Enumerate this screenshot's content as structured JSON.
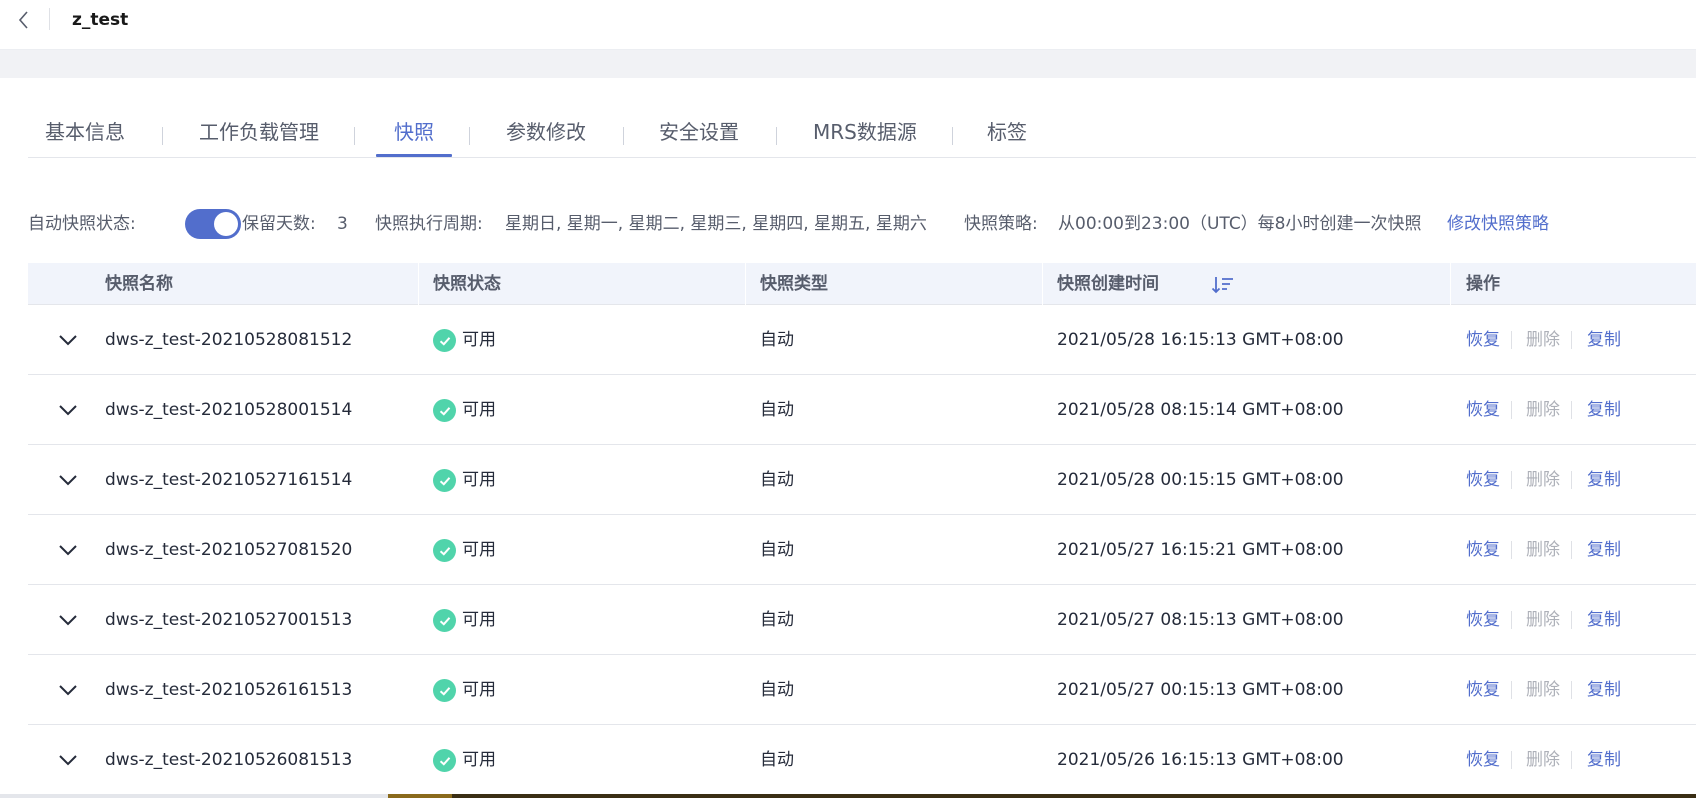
{
  "header": {
    "title": "z_test"
  },
  "tabs": [
    {
      "label": "基本信息",
      "active": false
    },
    {
      "label": "工作负载管理",
      "active": false
    },
    {
      "label": "快照",
      "active": true
    },
    {
      "label": "参数修改",
      "active": false
    },
    {
      "label": "安全设置",
      "active": false
    },
    {
      "label": "MRS数据源",
      "active": false
    },
    {
      "label": "标签",
      "active": false
    }
  ],
  "info": {
    "auto_label": "自动快照状态:",
    "auto_enabled": true,
    "retention_label": "保留天数:",
    "retention_value": "3",
    "period_label": "快照执行周期:",
    "period_value": "星期日, 星期一, 星期二, 星期三, 星期四, 星期五, 星期六",
    "policy_label": "快照策略:",
    "policy_value": "从00:00到23:00（UTC）每8小时创建一次快照",
    "modify_link": "修改快照策略"
  },
  "table": {
    "columns": [
      "快照名称",
      "快照状态",
      "快照类型",
      "快照创建时间",
      "操作"
    ],
    "actions": {
      "restore": "恢复",
      "delete": "删除",
      "copy": "复制"
    },
    "rows": [
      {
        "name": "dws-z_test-20210528081512",
        "status": "可用",
        "type": "自动",
        "created": "2021/05/28 16:15:13 GMT+08:00"
      },
      {
        "name": "dws-z_test-20210528001514",
        "status": "可用",
        "type": "自动",
        "created": "2021/05/28 08:15:14 GMT+08:00"
      },
      {
        "name": "dws-z_test-20210527161514",
        "status": "可用",
        "type": "自动",
        "created": "2021/05/28 00:15:15 GMT+08:00"
      },
      {
        "name": "dws-z_test-20210527081520",
        "status": "可用",
        "type": "自动",
        "created": "2021/05/27 16:15:21 GMT+08:00"
      },
      {
        "name": "dws-z_test-20210527001513",
        "status": "可用",
        "type": "自动",
        "created": "2021/05/27 08:15:13 GMT+08:00"
      },
      {
        "name": "dws-z_test-20210526161513",
        "status": "可用",
        "type": "自动",
        "created": "2021/05/27 00:15:13 GMT+08:00"
      },
      {
        "name": "dws-z_test-20210526081513",
        "status": "可用",
        "type": "自动",
        "created": "2021/05/26 16:15:13 GMT+08:00"
      }
    ]
  },
  "colors": {
    "accent": "#526ecc",
    "status_ok": "#50d4ab",
    "disabled": "#adb0b8"
  }
}
